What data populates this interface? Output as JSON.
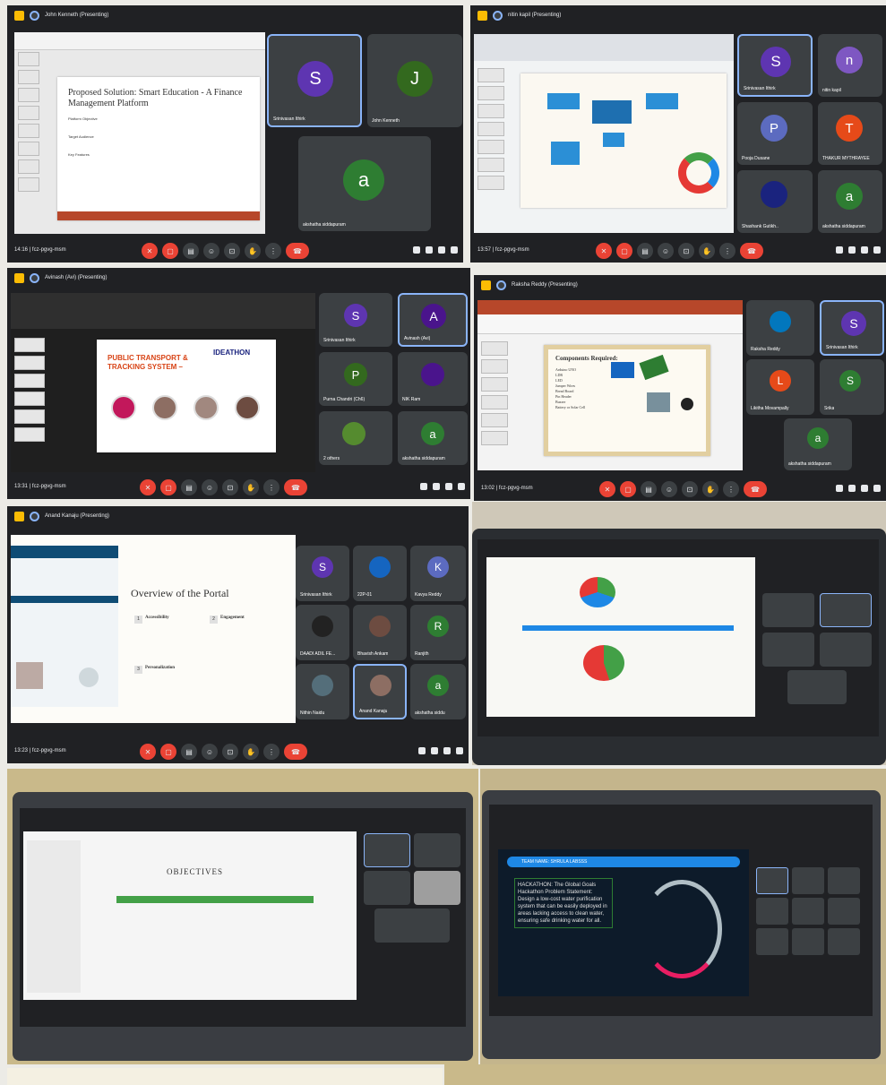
{
  "panel1": {
    "presenter_title": "John Kenneth (Presenting)",
    "slide_title": "Proposed Solution: Smart Education - A Finance Management Platform",
    "slide_points": [
      "Platform Objective",
      "Target Audience",
      "Key Features"
    ],
    "participants": [
      {
        "initial": "S",
        "name": "Srinivasan Ithirk",
        "color": "#5e35b1"
      },
      {
        "initial": "J",
        "name": "John Kenneth",
        "color": "#33691e"
      },
      {
        "initial": "a",
        "name": "akshatha siddapuram",
        "color": "#2e7d32"
      }
    ],
    "time": "14:16",
    "code": "fcz-pgvg-msm"
  },
  "panel2": {
    "presenter_title": "nitin kapil (Presenting)",
    "participants": [
      {
        "initial": "S",
        "name": "Srinivasan Ithirk",
        "color": "#5e35b1"
      },
      {
        "initial": "n",
        "name": "nitin kapil",
        "color": "#7e57c2"
      },
      {
        "initial": "P",
        "name": "Pooja Dusane",
        "color": "#5c6bc0"
      },
      {
        "initial": "T",
        "name": "THAKUR MYTHRAYEE",
        "color": "#e64a19"
      },
      {
        "initial": "",
        "name": "Shashank Gutikh..",
        "color": "#1a237e"
      },
      {
        "initial": "a",
        "name": "akshatha siddapuram",
        "color": "#2e7d32"
      }
    ],
    "time": "13:57",
    "code": "fcz-pgvg-msm"
  },
  "panel3": {
    "presenter_title": "Avinash (Avi) (Presenting)",
    "slide_title": "PUBLIC TRANSPORT & TRACKING SYSTEM –",
    "badge": "IDEATHON",
    "participants": [
      {
        "initial": "S",
        "name": "Srinivasan Ithirk",
        "color": "#5e35b1"
      },
      {
        "initial": "A",
        "name": "Avinash (Avi)",
        "color": "#4a148c"
      },
      {
        "initial": "P",
        "name": "Purna Chandri (Ch6)",
        "color": "#33691e"
      },
      {
        "initial": "",
        "name": "NIK Ram",
        "color": "#4a148c"
      },
      {
        "initial": "",
        "name": "2 others",
        "color": "#558b2f"
      },
      {
        "initial": "a",
        "name": "akshatha siddapuram",
        "color": "#2e7d32"
      }
    ],
    "time": "13:31",
    "code": "fcz-pgvg-msm"
  },
  "panel4": {
    "presenter_title": "Raksha Reddy (Presenting)",
    "slide_title": "Components Required:",
    "slide_items": [
      "Arduino UNO",
      "LDR",
      "LED",
      "Jumper Wires",
      "Bread Board",
      "Pin Header",
      "Buzzer",
      "Battery or Solar Cell"
    ],
    "participants": [
      {
        "initial": "",
        "name": "Raksha Reddy",
        "color": "#0277bd"
      },
      {
        "initial": "S",
        "name": "Srinivasan Ithirk",
        "color": "#5e35b1"
      },
      {
        "initial": "L",
        "name": "Likitha Movampally",
        "color": "#e64a19"
      },
      {
        "initial": "S",
        "name": "Srika",
        "color": "#2e7d32"
      },
      {
        "initial": "a",
        "name": "akshatha siddapuram",
        "color": "#2e7d32"
      }
    ],
    "time": "13:02",
    "code": "fcz-pgvg-msm"
  },
  "panel5": {
    "presenter_title": "Anand Kanaju (Presenting)",
    "slide_title": "Overview of the Portal",
    "features": [
      {
        "num": "1",
        "title": "Accessibility"
      },
      {
        "num": "2",
        "title": "Engagement"
      },
      {
        "num": "3",
        "title": "Personalization"
      }
    ],
    "participants": [
      {
        "initial": "S",
        "name": "Srinivasan Ithirk",
        "color": "#5e35b1"
      },
      {
        "initial": "",
        "name": "22P-01",
        "color": "#1565c0"
      },
      {
        "initial": "K",
        "name": "Kavya Reddy",
        "color": "#5c6bc0"
      },
      {
        "initial": "",
        "name": "DAADI ADIL FE...",
        "color": "#222222"
      },
      {
        "initial": "",
        "name": "Bhavish Ankam",
        "color": "#6d4c41"
      },
      {
        "initial": "R",
        "name": "Ranjith",
        "color": "#2e7d32"
      },
      {
        "initial": "",
        "name": "Nithin Naidu",
        "color": "#546e7a"
      },
      {
        "initial": "",
        "name": "Anand Kanaju",
        "color": "#8d6e63"
      },
      {
        "initial": "a",
        "name": "akshatha siddu",
        "color": "#2e7d32"
      }
    ],
    "time": "13:23",
    "code": "fcz-pgvg-msm"
  },
  "panel7": {
    "slide_title": "OBJECTIVES"
  },
  "panel8": {
    "team_banner": "TEAM NAME: SHRULA LABSSS",
    "body_text": "HACKATHON: The Global Goals Hackathon Problem Statement: Design a low-cost water purification system that can be easily deployed in areas lacking access to clean water, ensuring safe drinking water for all."
  },
  "colors": {
    "meet_dark": "#202124",
    "tile": "#3c4043",
    "end_call": "#ea4335",
    "accent": "#8ab4f8",
    "app_icon": "#fbbc04"
  }
}
